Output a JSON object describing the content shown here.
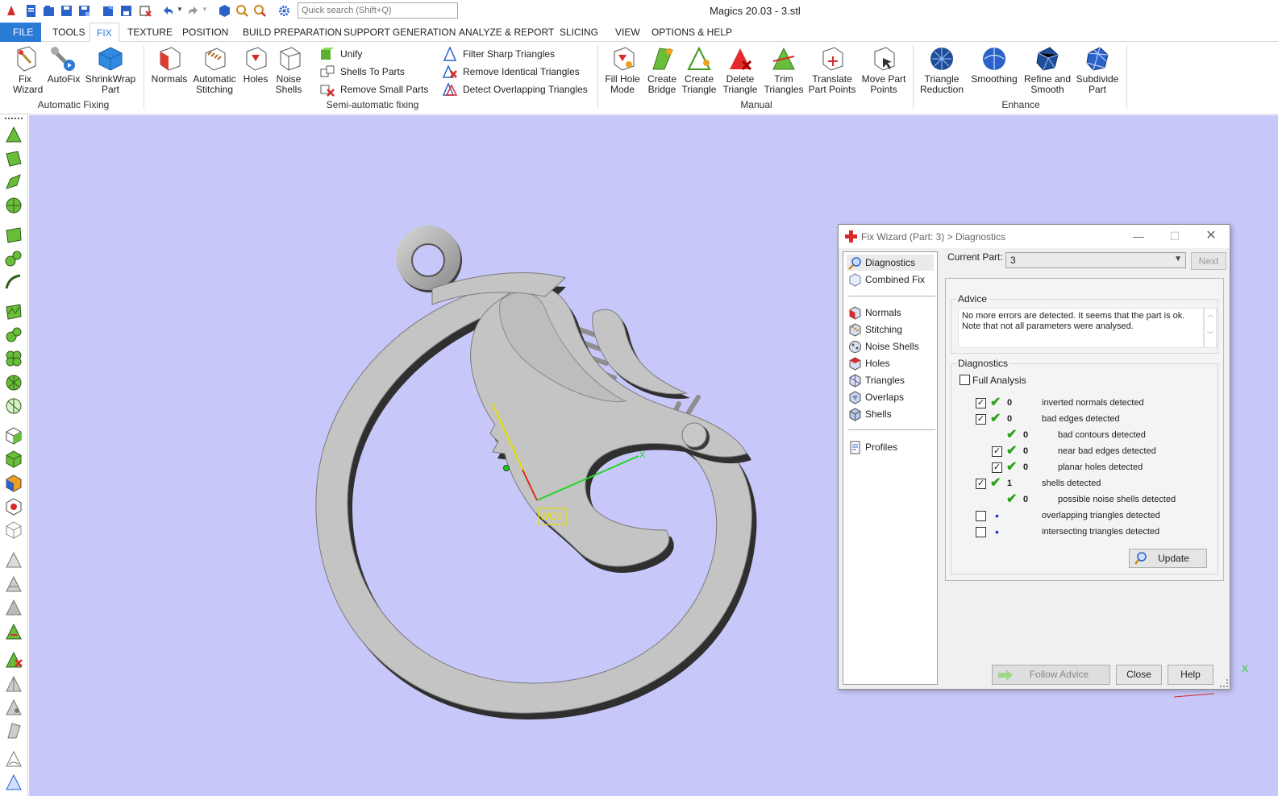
{
  "app": {
    "title": "Magics 20.03 - 3.stl"
  },
  "search": {
    "placeholder": "Quick search (Shift+Q)"
  },
  "menu": {
    "tabs": [
      "FILE",
      "TOOLS",
      "FIX",
      "TEXTURE",
      "POSITION",
      "BUILD PREPARATION",
      "SUPPORT GENERATION",
      "ANALYZE & REPORT",
      "SLICING",
      "VIEW",
      "OPTIONS & HELP"
    ],
    "active": "FIX"
  },
  "ribbon": {
    "auto": {
      "fix_wizard": "Fix Wizard",
      "autofix": "AutoFix",
      "shrinkwrap": "ShrinkWrap Part",
      "label": "Automatic Fixing"
    },
    "semi": {
      "normals": "Normals",
      "auto_stitch": "Automatic Stitching",
      "holes": "Holes",
      "noise_shells": "Noise Shells",
      "unify": "Unify",
      "shells_to_parts": "Shells To Parts",
      "remove_small_parts": "Remove Small Parts",
      "filter_sharp": "Filter Sharp Triangles",
      "remove_identical": "Remove Identical Triangles",
      "detect_overlapping": "Detect Overlapping Triangles",
      "label": "Semi-automatic fixing"
    },
    "manual": {
      "fill_hole": "Fill Hole Mode",
      "create_bridge": "Create Bridge",
      "create_triangle": "Create Triangle",
      "delete_triangle": "Delete Triangle",
      "trim_triangles": "Trim Triangles",
      "translate_points": "Translate Part Points",
      "move_points": "Move Part Points",
      "label": "Manual"
    },
    "enhance": {
      "triangle_reduction": "Triangle Reduction",
      "smoothing": "Smoothing",
      "refine_smooth": "Refine and Smooth",
      "subdivide": "Subdivide Part",
      "label": "Enhance"
    }
  },
  "viewport": {
    "background": "#c7c8f9",
    "axis_x": "X",
    "axis_y": "Y",
    "wcs_label": "WCS"
  },
  "dialog": {
    "title": "Fix Wizard (Part: 3) > Diagnostics",
    "nav": {
      "diagnostics": "Diagnostics",
      "combined_fix": "Combined Fix",
      "normals": "Normals",
      "stitching": "Stitching",
      "noise_shells": "Noise Shells",
      "holes": "Holes",
      "triangles": "Triangles",
      "overlaps": "Overlaps",
      "shells": "Shells",
      "profiles": "Profiles"
    },
    "current_part_label": "Current Part:",
    "current_part_value": "3",
    "next": "Next",
    "advice": {
      "legend": "Advice",
      "text": "No more errors are detected. It seems that the part is ok. Note that not all parameters were analysed."
    },
    "diagnostics": {
      "legend": "Diagnostics",
      "full_analysis": "Full Analysis",
      "items": [
        {
          "count": "0",
          "text": "inverted normals detected"
        },
        {
          "count": "0",
          "text": "bad edges detected"
        },
        {
          "count": "0",
          "text": "bad contours detected"
        },
        {
          "count": "0",
          "text": "near bad edges detected"
        },
        {
          "count": "0",
          "text": "planar holes detected"
        },
        {
          "count": "1",
          "text": "shells detected"
        },
        {
          "count": "0",
          "text": "possible noise shells detected"
        },
        {
          "count": "",
          "text": "overlapping triangles detected"
        },
        {
          "count": "",
          "text": "intersecting triangles detected"
        }
      ]
    },
    "update": "Update",
    "follow_advice": "Follow Advice",
    "close": "Close",
    "help": "Help"
  }
}
